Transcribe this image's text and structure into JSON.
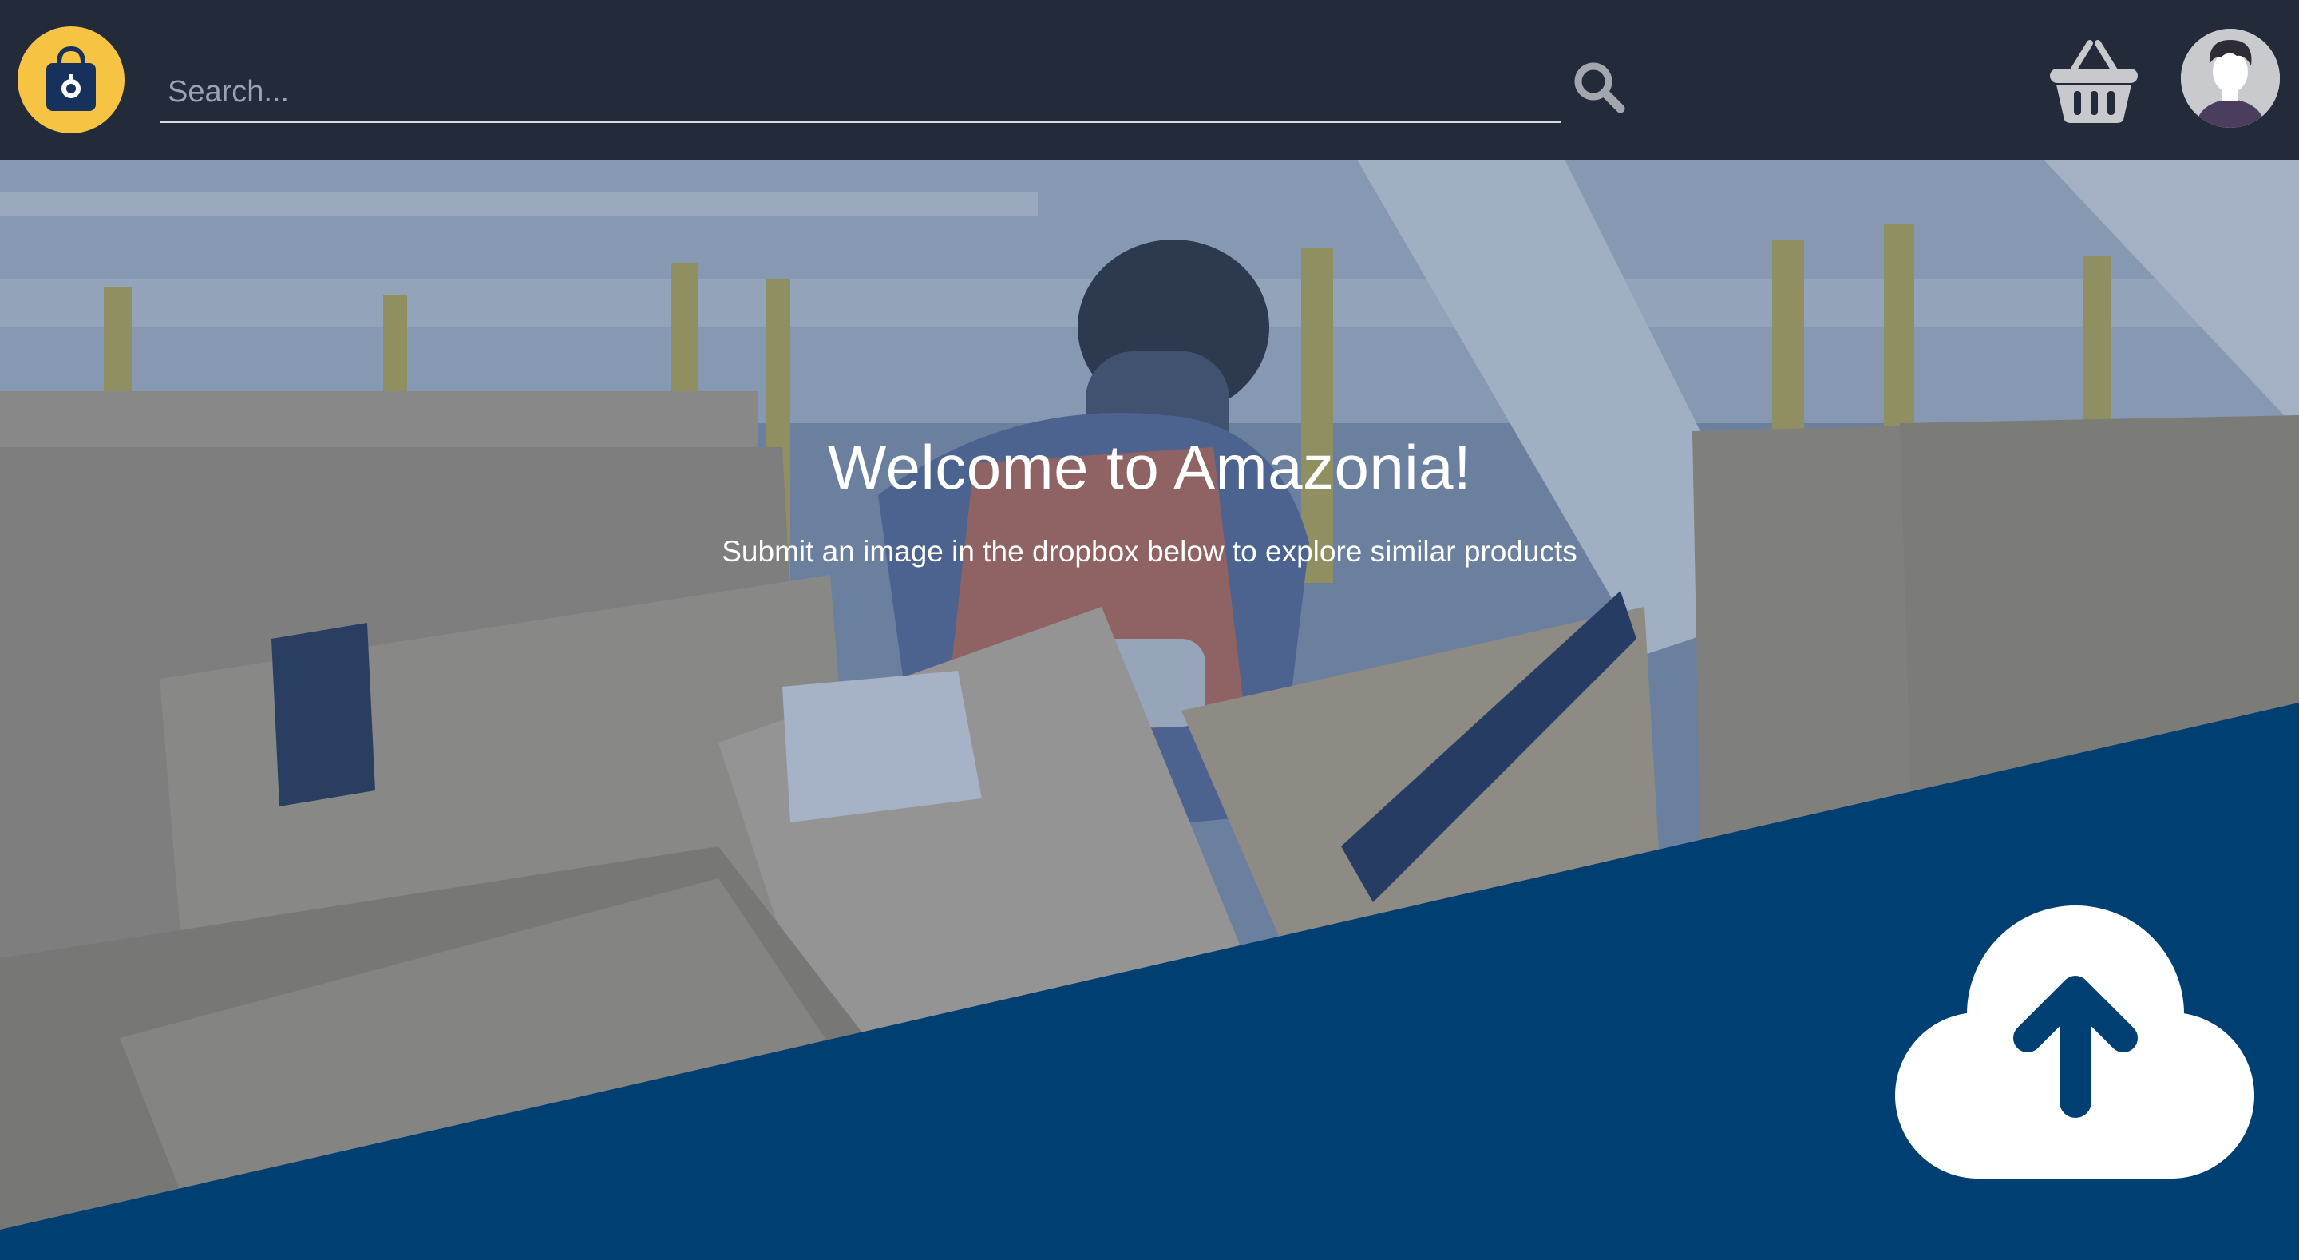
{
  "header": {
    "logo_icon": "shopping-bag-icon",
    "search": {
      "placeholder": "Search...",
      "value": ""
    },
    "search_icon": "search-icon",
    "cart_icon": "basket-icon",
    "avatar_icon": "user-avatar"
  },
  "hero": {
    "title": "Welcome to Amazonia!",
    "subtitle": "Submit an image in the dropbox below to explore similar products",
    "background": "warehouse-worker-photo",
    "upload_icon": "cloud-upload-icon"
  },
  "colors": {
    "navbar": "#232a3a",
    "logo_accent": "#f6c343",
    "hero_overlay": "#2f4d7c",
    "diagonal_panel": "#003f72",
    "upload_icon": "#ffffff"
  }
}
